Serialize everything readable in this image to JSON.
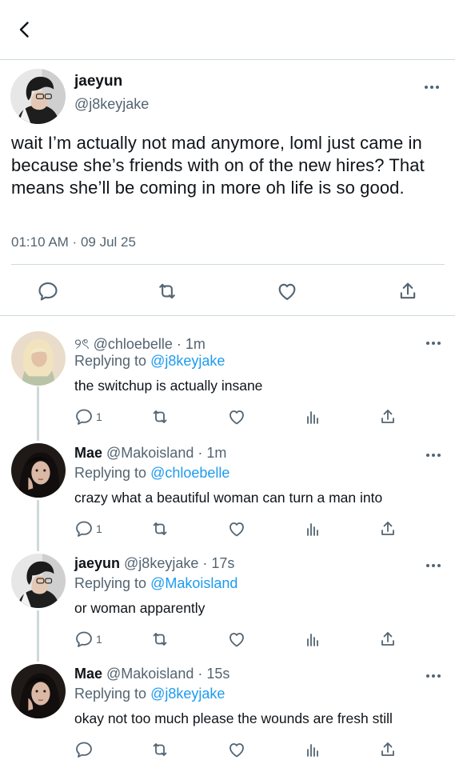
{
  "main_tweet": {
    "name": "jaeyun",
    "handle": "@j8keyjake",
    "text": "wait I’m actually not mad anymore, loml just came in because she’s friends with on of the new hires? That means she’ll be coming in more oh life is so good.",
    "time": "01:10 AM",
    "separator": " · ",
    "date": "09 Jul 25"
  },
  "replies": [
    {
      "name": "",
      "handle": "୨ৎ @chloebelle",
      "time": " · 1m",
      "replying_prefix": "Replying to ",
      "replying_to": "@j8keyjake",
      "text": "the switchup is actually insane",
      "reply_count": "1"
    },
    {
      "name": "Mae",
      "handle": " @Makoisland",
      "time": " · 1m",
      "replying_prefix": "Replying to ",
      "replying_to": "@chloebelle",
      "text": "crazy what a beautiful woman can turn a man into",
      "reply_count": "1"
    },
    {
      "name": "jaeyun",
      "handle": " @j8keyjake",
      "time": " · 17s",
      "replying_prefix": "Replying to ",
      "replying_to": "@Makoisland",
      "text": "or woman apparently",
      "reply_count": "1"
    },
    {
      "name": "Mae",
      "handle": " @Makoisland",
      "time": " · 15s",
      "replying_prefix": "Replying to ",
      "replying_to": "@j8keyjake",
      "text": "okay not too much please the wounds are fresh still",
      "reply_count": ""
    }
  ],
  "colors": {
    "accent": "#1d9bf0",
    "secondary_text": "#536471",
    "divider": "#cfd9de"
  },
  "icons": [
    "back-arrow-icon",
    "more-icon",
    "reply-icon",
    "retweet-icon",
    "like-icon",
    "share-icon",
    "analytics-icon"
  ]
}
